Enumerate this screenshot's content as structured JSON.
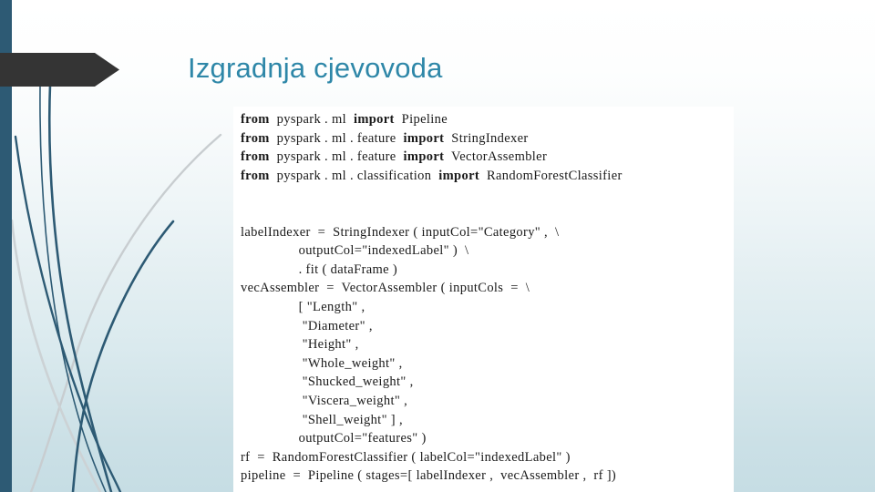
{
  "slide": {
    "title": "Izgradnja cjevovoda",
    "title_color": "#2e87a8",
    "background_top_color": "#ffffff",
    "background_bottom_color": "#c6dde4",
    "accent_bar_color": "#2d5a74",
    "arrow_color": "#343434",
    "swoosh_dark_color": "#2d5a74",
    "swoosh_light_color": "#c8cdd0"
  },
  "code_block": {
    "background_color": "#ffffff",
    "language": "python",
    "lines": [
      {
        "indent": 0,
        "segments": [
          {
            "text": "from",
            "bold": true
          },
          {
            "text": "  pyspark . ml  ",
            "bold": false
          },
          {
            "text": "import",
            "bold": true
          },
          {
            "text": "  Pipeline",
            "bold": false
          }
        ]
      },
      {
        "indent": 0,
        "segments": [
          {
            "text": "from",
            "bold": true
          },
          {
            "text": "  pyspark . ml . feature  ",
            "bold": false
          },
          {
            "text": "import",
            "bold": true
          },
          {
            "text": "  StringIndexer",
            "bold": false
          }
        ]
      },
      {
        "indent": 0,
        "segments": [
          {
            "text": "from",
            "bold": true
          },
          {
            "text": "  pyspark . ml . feature  ",
            "bold": false
          },
          {
            "text": "import",
            "bold": true
          },
          {
            "text": "  VectorAssembler",
            "bold": false
          }
        ]
      },
      {
        "indent": 0,
        "segments": [
          {
            "text": "from",
            "bold": true
          },
          {
            "text": "  pyspark . ml . classification  ",
            "bold": false
          },
          {
            "text": "import",
            "bold": true
          },
          {
            "text": "  RandomForestClassifier",
            "bold": false
          }
        ]
      },
      {
        "indent": 0,
        "segments": [
          {
            "text": "",
            "bold": false
          }
        ]
      },
      {
        "indent": 0,
        "segments": [
          {
            "text": "",
            "bold": false
          }
        ]
      },
      {
        "indent": 0,
        "segments": [
          {
            "text": "labelIndexer  =  StringIndexer ( inputCol=\"Category\" ,  \\",
            "bold": false
          }
        ]
      },
      {
        "indent": 0,
        "segments": [
          {
            "text": "                outputCol=\"indexedLabel\" )  \\",
            "bold": false
          }
        ]
      },
      {
        "indent": 0,
        "segments": [
          {
            "text": "                . fit ( dataFrame )",
            "bold": false
          }
        ]
      },
      {
        "indent": 0,
        "segments": [
          {
            "text": "vecAssembler  =  VectorAssembler ( inputCols  =  \\",
            "bold": false
          }
        ]
      },
      {
        "indent": 0,
        "segments": [
          {
            "text": "                [ \"Length\" ,",
            "bold": false
          }
        ]
      },
      {
        "indent": 0,
        "segments": [
          {
            "text": "                 \"Diameter\" ,",
            "bold": false
          }
        ]
      },
      {
        "indent": 0,
        "segments": [
          {
            "text": "                 \"Height\" ,",
            "bold": false
          }
        ]
      },
      {
        "indent": 0,
        "segments": [
          {
            "text": "                 \"Whole_weight\" ,",
            "bold": false
          }
        ]
      },
      {
        "indent": 0,
        "segments": [
          {
            "text": "                 \"Shucked_weight\" ,",
            "bold": false
          }
        ]
      },
      {
        "indent": 0,
        "segments": [
          {
            "text": "                 \"Viscera_weight\" ,",
            "bold": false
          }
        ]
      },
      {
        "indent": 0,
        "segments": [
          {
            "text": "                 \"Shell_weight\" ] ,",
            "bold": false
          }
        ]
      },
      {
        "indent": 0,
        "segments": [
          {
            "text": "                outputCol=\"features\" )",
            "bold": false
          }
        ]
      },
      {
        "indent": 0,
        "segments": [
          {
            "text": "rf  =  RandomForestClassifier ( labelCol=\"indexedLabel\" )",
            "bold": false
          }
        ]
      },
      {
        "indent": 0,
        "segments": [
          {
            "text": "pipeline  =  Pipeline ( stages=[ labelIndexer ,  vecAssembler ,  rf ])",
            "bold": false
          }
        ]
      }
    ]
  }
}
